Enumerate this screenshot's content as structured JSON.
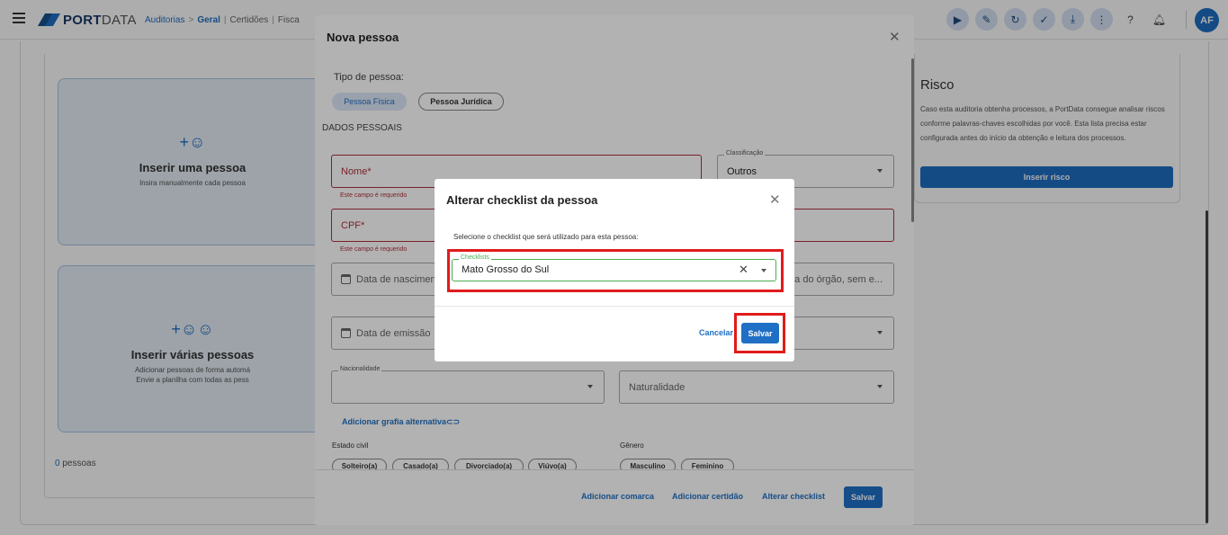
{
  "header": {
    "logo_bold": "PORT",
    "logo_light": "DATA",
    "breadcrumb": [
      "Auditorias",
      "Geral",
      "Certidões",
      "Fisca"
    ],
    "avatar_initials": "AF",
    "icons": [
      "play-circle-icon",
      "edit-icon",
      "refresh-icon",
      "shield-check-icon",
      "download-icon",
      "more-vert-icon",
      "help-icon",
      "bell-icon"
    ]
  },
  "background": {
    "card_one": {
      "title": "Inserir uma pessoa",
      "desc": "Insira manualmente cada pessoa"
    },
    "card_many": {
      "title": "Inserir várias pessoas",
      "desc1": "Adicionar pessoas de forma automá",
      "desc2": "Envie a planilha com todas as pess"
    },
    "people_count": "0",
    "people_label": "pessoas",
    "risk": {
      "title": "Risco",
      "desc": "Caso esta auditoria obtenha processos, a PortData consegue analisar riscos conforme palavras-chaves escolhidas por você. Esta lista precisa estar configurada antes do início da obtenção e leitura dos processos.",
      "button": "Inserir risco"
    }
  },
  "modal": {
    "title": "Nova pessoa",
    "tipo_label": "Tipo de pessoa:",
    "tipos": [
      "Pessoa Física",
      "Pessoa Jurídica"
    ],
    "section": "DADOS PESSOAIS",
    "nome": "Nome*",
    "cpf": "CPF*",
    "error": "Este campo é requerido",
    "classificacao_label": "Classificação",
    "classificacao_value": "Outros",
    "nascimento": "Data de nascimen",
    "orgao": "la do órgão, sem e...",
    "emissao": "Data de emissão",
    "nacionalidade_label": "Nacionalidade",
    "naturalidade": "Naturalidade",
    "grafia_link": "Adicionar grafia alternativa",
    "estado_civil_label": "Estado civil",
    "estado_civil": [
      "Solteiro(a)",
      "Casado(a)",
      "Divorciado(a)",
      "Viúvo(a)"
    ],
    "genero_label": "Gênero",
    "genero": [
      "Masculino",
      "Feminino"
    ],
    "footer": {
      "comarca": "Adicionar comarca",
      "certidao": "Adicionar certidão",
      "checklist": "Alterar checklist",
      "save": "Salvar"
    }
  },
  "dialog": {
    "title": "Alterar checklist da pessoa",
    "desc": "Selecione o checklist que será utilizado para esta pessoa:",
    "field_label": "Checklists",
    "field_value": "Mato Grosso do Sul",
    "cancel": "Cancelar",
    "save": "Salvar"
  },
  "colors": {
    "primary": "#1f6fc5",
    "error": "#b0303b",
    "highlight": "#e11b1b",
    "focus": "#4caf50"
  }
}
